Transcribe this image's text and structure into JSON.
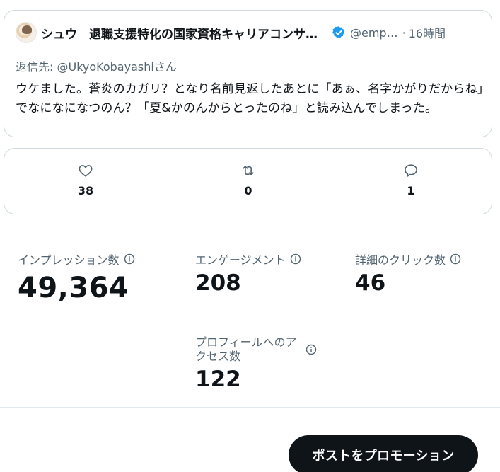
{
  "tweet": {
    "display_name": "シュウ　退職支援特化の国家資格キャリアコンサ…",
    "handle": "@emp…",
    "separator": "·",
    "time": "16時間",
    "reply_prefix": "返信先: ",
    "reply_user": "@UkyoKobayashiさん",
    "text": "ウケました。蒼炎のカガリ？となり名前見返したあとに「あぁ、名字かがりだからね」でなになになつのん？「夏&かのんからとったのね」と読み込んでしまった。"
  },
  "actions": {
    "likes": "38",
    "retweets": "0",
    "replies": "1"
  },
  "metrics": {
    "impressions": {
      "label": "インプレッション数",
      "value": "49,364"
    },
    "engagements": {
      "label": "エンゲージメント",
      "value": "208"
    },
    "detail_clicks": {
      "label": "詳細のクリック数",
      "value": "46"
    },
    "profile_visits": {
      "label": "プロフィールへのアクセス数",
      "value": "122"
    }
  },
  "promote": {
    "label": "ポストをプロモーション"
  },
  "colors": {
    "text": "#0f1419",
    "secondary": "#536471",
    "verified": "#1d9bf0",
    "border": "#cfd9de"
  },
  "icons": [
    "avatar",
    "verified-badge-icon",
    "like-heart-icon",
    "retweet-icon",
    "reply-bubble-icon",
    "info-icon"
  ]
}
